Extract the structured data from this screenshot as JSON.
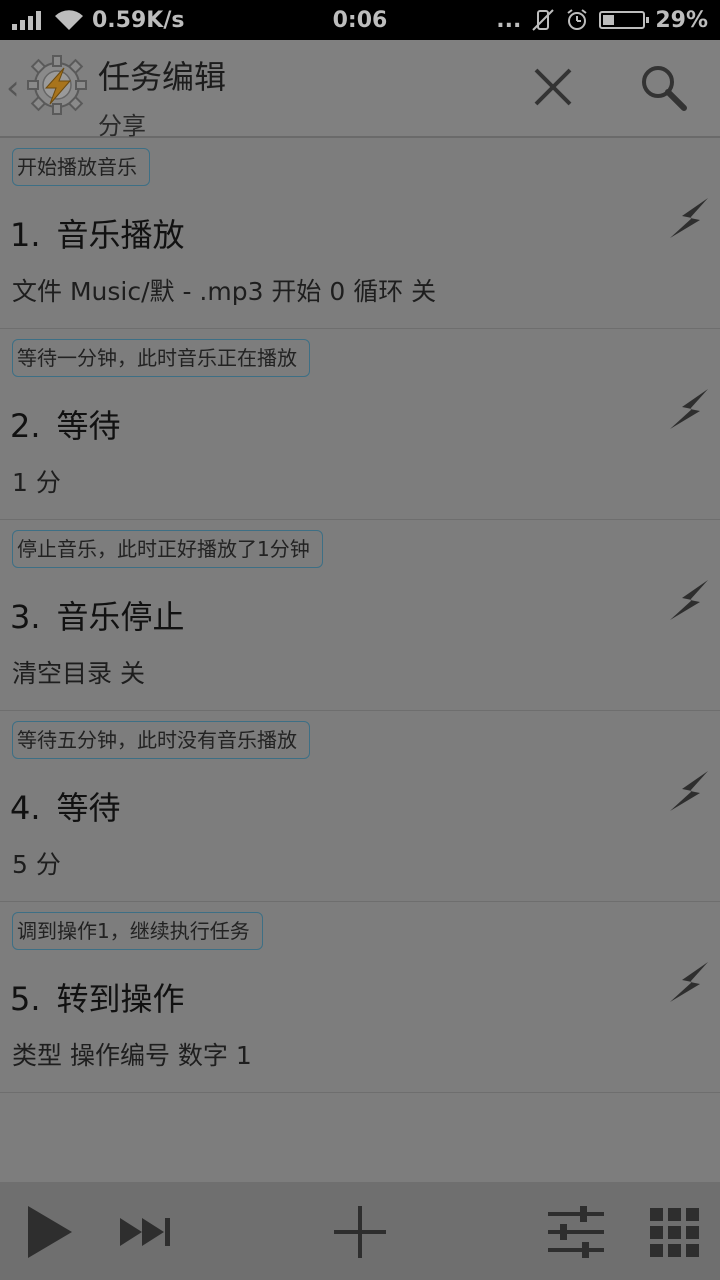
{
  "status_bar": {
    "speed": "0.59K/s",
    "time": "0:06",
    "dots": "...",
    "battery": "29%",
    "battery_level": 0.29
  },
  "header": {
    "title": "任务编辑",
    "subtitle": "分享",
    "back_glyph": "‹"
  },
  "actions": [
    {
      "label": "开始播放音乐",
      "number": "1.",
      "name": "音乐播放",
      "detail": "文件 Music/默 - .mp3 开始 0 循环 关"
    },
    {
      "label": "等待一分钟，此时音乐正在播放",
      "number": "2.",
      "name": "等待",
      "detail": "1 分"
    },
    {
      "label": "停止音乐，此时正好播放了1分钟",
      "number": "3.",
      "name": "音乐停止",
      "detail": "清空目录 关"
    },
    {
      "label": "等待五分钟，此时没有音乐播放",
      "number": "4.",
      "name": "等待",
      "detail": "5 分"
    },
    {
      "label": "调到操作1，继续执行任务",
      "number": "5.",
      "name": "转到操作",
      "detail": "类型 操作编号 数字 1"
    }
  ],
  "icons": {
    "signal": "signal-icon",
    "wifi": "wifi-icon",
    "mute": "vibrate-off-icon",
    "alarm": "alarm-icon",
    "logo": "tasker-gear-bolt-icon",
    "close": "close-icon",
    "search": "search-icon",
    "bolt": "bolt-icon",
    "play": "play-icon",
    "skip": "skip-forward-icon",
    "add": "plus-icon",
    "sliders": "sliders-icon",
    "grid": "grid-icon"
  },
  "colors": {
    "label_border": "#3d6f85",
    "background": "#7d7d7d"
  }
}
